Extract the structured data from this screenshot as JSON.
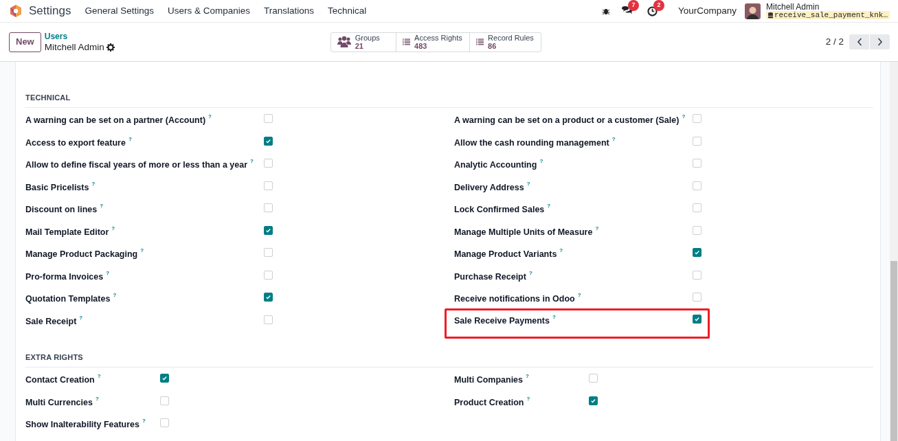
{
  "navbar": {
    "app": "Settings",
    "menu": [
      "General Settings",
      "Users & Companies",
      "Translations",
      "Technical"
    ],
    "messages_count": "7",
    "activities_count": "2",
    "company": "YourCompany",
    "user": "Mitchell Admin",
    "database": "receive_sale_payment_knk…"
  },
  "control_panel": {
    "new_button": "New",
    "breadcrumb": "Users",
    "record": "Mitchell Admin",
    "stats": [
      {
        "label": "Groups",
        "value": "21",
        "kind": "groups"
      },
      {
        "label": "Access Rights",
        "value": "483",
        "kind": "list"
      },
      {
        "label": "Record Rules",
        "value": "86",
        "kind": "list"
      }
    ],
    "pager": "2 / 2"
  },
  "sections": [
    {
      "title": "TECHNICAL",
      "kind": "wide",
      "columns": [
        [
          {
            "label": "A warning can be set on a partner (Account)",
            "help": "?",
            "checked": false,
            "highlighted": false
          },
          {
            "label": "Access to export feature",
            "help": "?",
            "checked": true,
            "highlighted": false
          },
          {
            "label": "Allow to define fiscal years of more or less than a year",
            "help": "?",
            "checked": false,
            "highlighted": false
          },
          {
            "label": "Basic Pricelists",
            "help": "?",
            "checked": false,
            "highlighted": false
          },
          {
            "label": "Discount on lines",
            "help": "?",
            "checked": false,
            "highlighted": false
          },
          {
            "label": "Mail Template Editor",
            "help": "?",
            "checked": true,
            "highlighted": false
          },
          {
            "label": "Manage Product Packaging",
            "help": "?",
            "checked": false,
            "highlighted": false
          },
          {
            "label": "Pro-forma Invoices",
            "help": "?",
            "checked": false,
            "highlighted": false
          },
          {
            "label": "Quotation Templates",
            "help": "?",
            "checked": true,
            "highlighted": false
          },
          {
            "label": "Sale Receipt",
            "help": "?",
            "checked": false,
            "highlighted": false
          }
        ],
        [
          {
            "label": "A warning can be set on a product or a customer (Sale)",
            "help": "?",
            "checked": false,
            "highlighted": false
          },
          {
            "label": "Allow the cash rounding management",
            "help": "?",
            "checked": false,
            "highlighted": false
          },
          {
            "label": "Analytic Accounting",
            "help": "?",
            "checked": false,
            "highlighted": false
          },
          {
            "label": "Delivery Address",
            "help": "?",
            "checked": false,
            "highlighted": false
          },
          {
            "label": "Lock Confirmed Sales",
            "help": "?",
            "checked": false,
            "highlighted": false
          },
          {
            "label": "Manage Multiple Units of Measure",
            "help": "?",
            "checked": false,
            "highlighted": false
          },
          {
            "label": "Manage Product Variants",
            "help": "?",
            "checked": true,
            "highlighted": false
          },
          {
            "label": "Purchase Receipt",
            "help": "?",
            "checked": false,
            "highlighted": false
          },
          {
            "label": "Receive notifications in Odoo",
            "help": "?",
            "checked": false,
            "highlighted": false
          },
          {
            "label": "Sale Receive Payments",
            "help": "?",
            "checked": true,
            "highlighted": true
          }
        ]
      ]
    },
    {
      "title": "EXTRA RIGHTS",
      "kind": "narrow",
      "columns": [
        [
          {
            "label": "Contact Creation",
            "help": "?",
            "checked": true,
            "highlighted": false
          },
          {
            "label": "Multi Currencies",
            "help": "?",
            "checked": false,
            "highlighted": false
          },
          {
            "label": "Show Inalterability Features",
            "help": "?",
            "checked": false,
            "highlighted": false
          }
        ],
        [
          {
            "label": "Multi Companies",
            "help": "?",
            "checked": false,
            "highlighted": false
          },
          {
            "label": "Product Creation",
            "help": "?",
            "checked": true,
            "highlighted": false
          }
        ]
      ]
    }
  ]
}
